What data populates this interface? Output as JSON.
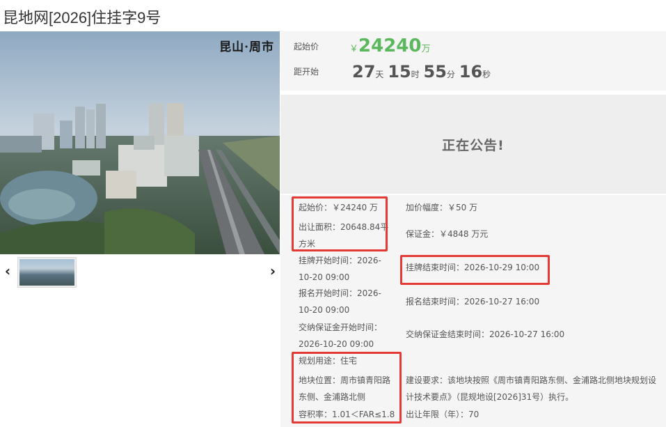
{
  "page": {
    "title": "昆地网[2026]住挂字9号"
  },
  "photo": {
    "caption": "昆山·周市"
  },
  "gallery": {
    "prev_icon": "‹",
    "next_icon": "›"
  },
  "pricing": {
    "start_price_label": "起始价",
    "currency_symbol": "￥",
    "start_price_value": "24240",
    "start_price_unit": "万",
    "countdown_label": "距开始",
    "days": "27",
    "days_unit": "天",
    "hours": "15",
    "hours_unit": "时",
    "minutes": "55",
    "minutes_unit": "分",
    "seconds": "16",
    "seconds_unit": "秒"
  },
  "status": {
    "text": "正在公告!"
  },
  "details": {
    "start_price": {
      "label": "起始价：",
      "value": "￥24240 万"
    },
    "increment": {
      "label": "加价幅度：",
      "value": "￥50 万"
    },
    "area": {
      "label": "出让面积：",
      "value": "20648.84平",
      "value2": "方米"
    },
    "deposit": {
      "label": "保证金：",
      "value": "￥4848 万元"
    },
    "listing_start": {
      "label": "挂牌开始时间：",
      "value": "2026-",
      "value2": "10-20 09:00"
    },
    "listing_end": {
      "label": "挂牌结束时间：",
      "value": "2026-10-29 10:00"
    },
    "signup_start": {
      "label": "报名开始时间：",
      "value": "2026-",
      "value2": "10-20 09:00"
    },
    "signup_end": {
      "label": "报名结束时间：",
      "value": "2026-10-27 16:00"
    },
    "deposit_start": {
      "label": "交纳保证金开始时间：",
      "value": "2026-10-20 09:00"
    },
    "deposit_end": {
      "label": "交纳保证金结束时间：",
      "value": "2026-10-27 16:00"
    },
    "usage": {
      "label": "规划用途：",
      "value": "住宅"
    },
    "location": {
      "label": "地块位置：",
      "value": "周市镇青阳路",
      "value2": "东侧、金浦路北侧"
    },
    "build_req": {
      "label": "建设要求：",
      "value": "该地块按照《周市镇青阳路东侧、金浦路北侧地块规划设",
      "value2": "计技术要点》（昆规地设[2026]31号）执行。"
    },
    "far": {
      "label": "容积率：",
      "value": "1.01＜FAR≤1.8"
    },
    "term": {
      "label": "出让年限（年）：",
      "value": "70"
    }
  },
  "colors": {
    "price_green": "#5cb85c",
    "highlight_red": "#e53935",
    "panel_bg": "#f5f5f5",
    "notice_bg": "#eeeeee"
  }
}
